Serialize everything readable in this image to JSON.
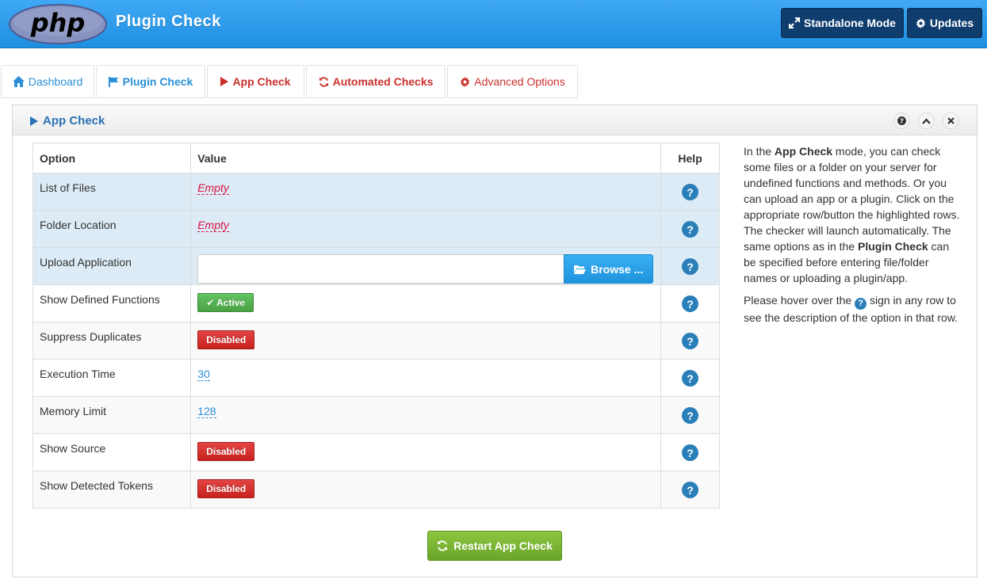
{
  "header": {
    "title": "Plugin Check",
    "logo_text": "php",
    "buttons": {
      "standalone": "Standalone Mode",
      "updates": "Updates"
    }
  },
  "tabs": [
    {
      "label": "Dashboard",
      "icon": "home-icon"
    },
    {
      "label": "Plugin Check",
      "icon": "flag-icon"
    },
    {
      "label": "App Check",
      "icon": "play-icon"
    },
    {
      "label": "Automated Checks",
      "icon": "refresh-icon"
    },
    {
      "label": "Advanced Options",
      "icon": "gear-icon"
    }
  ],
  "panel": {
    "title": "App Check"
  },
  "table": {
    "headers": {
      "option": "Option",
      "value": "Value",
      "help": "Help"
    },
    "rows": [
      {
        "option": "List of Files",
        "value": "Empty"
      },
      {
        "option": "Folder Location",
        "value": "Empty"
      },
      {
        "option": "Upload Application",
        "value": "",
        "button": "Browse ..."
      },
      {
        "option": "Show Defined Functions",
        "value": "Active"
      },
      {
        "option": "Suppress Duplicates",
        "value": "Disabled"
      },
      {
        "option": "Execution Time",
        "value": "30"
      },
      {
        "option": "Memory Limit",
        "value": "128"
      },
      {
        "option": "Show Source",
        "value": "Disabled"
      },
      {
        "option": "Show Detected Tokens",
        "value": "Disabled"
      }
    ],
    "help_glyph": "?"
  },
  "help_text": {
    "p1_a": "In the ",
    "p1_b": "App Check",
    "p1_c": " mode, you can check some files or a folder on your server for undefined functions and methods. Or you can upload an app or a plugin. Click on the appropriate row/button the highlighted rows. The checker will launch automatically. The same options as in the ",
    "p1_d": "Plugin Check",
    "p1_e": " can be specified before entering file/folder names or uploading a plugin/app.",
    "p2_a": "Please hover over the ",
    "p2_b": " sign in any row to see the description of the option in that row."
  },
  "restart_button": "Restart App Check",
  "colors": {
    "header_blue": "#2a9ae8",
    "header_button": "#0f3d6e",
    "highlight_row": "#dcebf5",
    "active_green": "#5cb85c",
    "disabled_red": "#d9322c",
    "restart_green": "#7ab535"
  }
}
